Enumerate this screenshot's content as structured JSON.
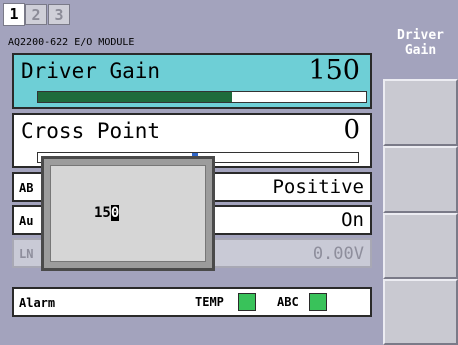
{
  "tabs": [
    "1",
    "2",
    "3"
  ],
  "module_title": "AQ2200-622 E/O MODULE",
  "driver_gain": {
    "label": "Driver Gain",
    "value": "150",
    "level": 0.59
  },
  "cross_point": {
    "label": "Cross Point",
    "value": "0",
    "marker": 0.49
  },
  "rows": {
    "abc": {
      "label": "AB",
      "value": "Positive"
    },
    "auto": {
      "label": "Au",
      "value": "On"
    },
    "ln_bias": {
      "label": "LN Bias Set",
      "value": "0.00V"
    },
    "alarm": {
      "label": "Alarm",
      "temp_label": "TEMP",
      "abc_label": "ABC"
    }
  },
  "popup": {
    "value_prefix": "15",
    "value_cursor": "0"
  },
  "softkeys": [
    "Driver\nGain",
    "",
    "",
    "",
    ""
  ],
  "colors": {
    "panel": "#a3a3bd",
    "selected_row": "#6ecfd6",
    "gain_bar": "#1e6b3c",
    "marker": "#2f66c8",
    "led_ok": "#39c25a"
  }
}
